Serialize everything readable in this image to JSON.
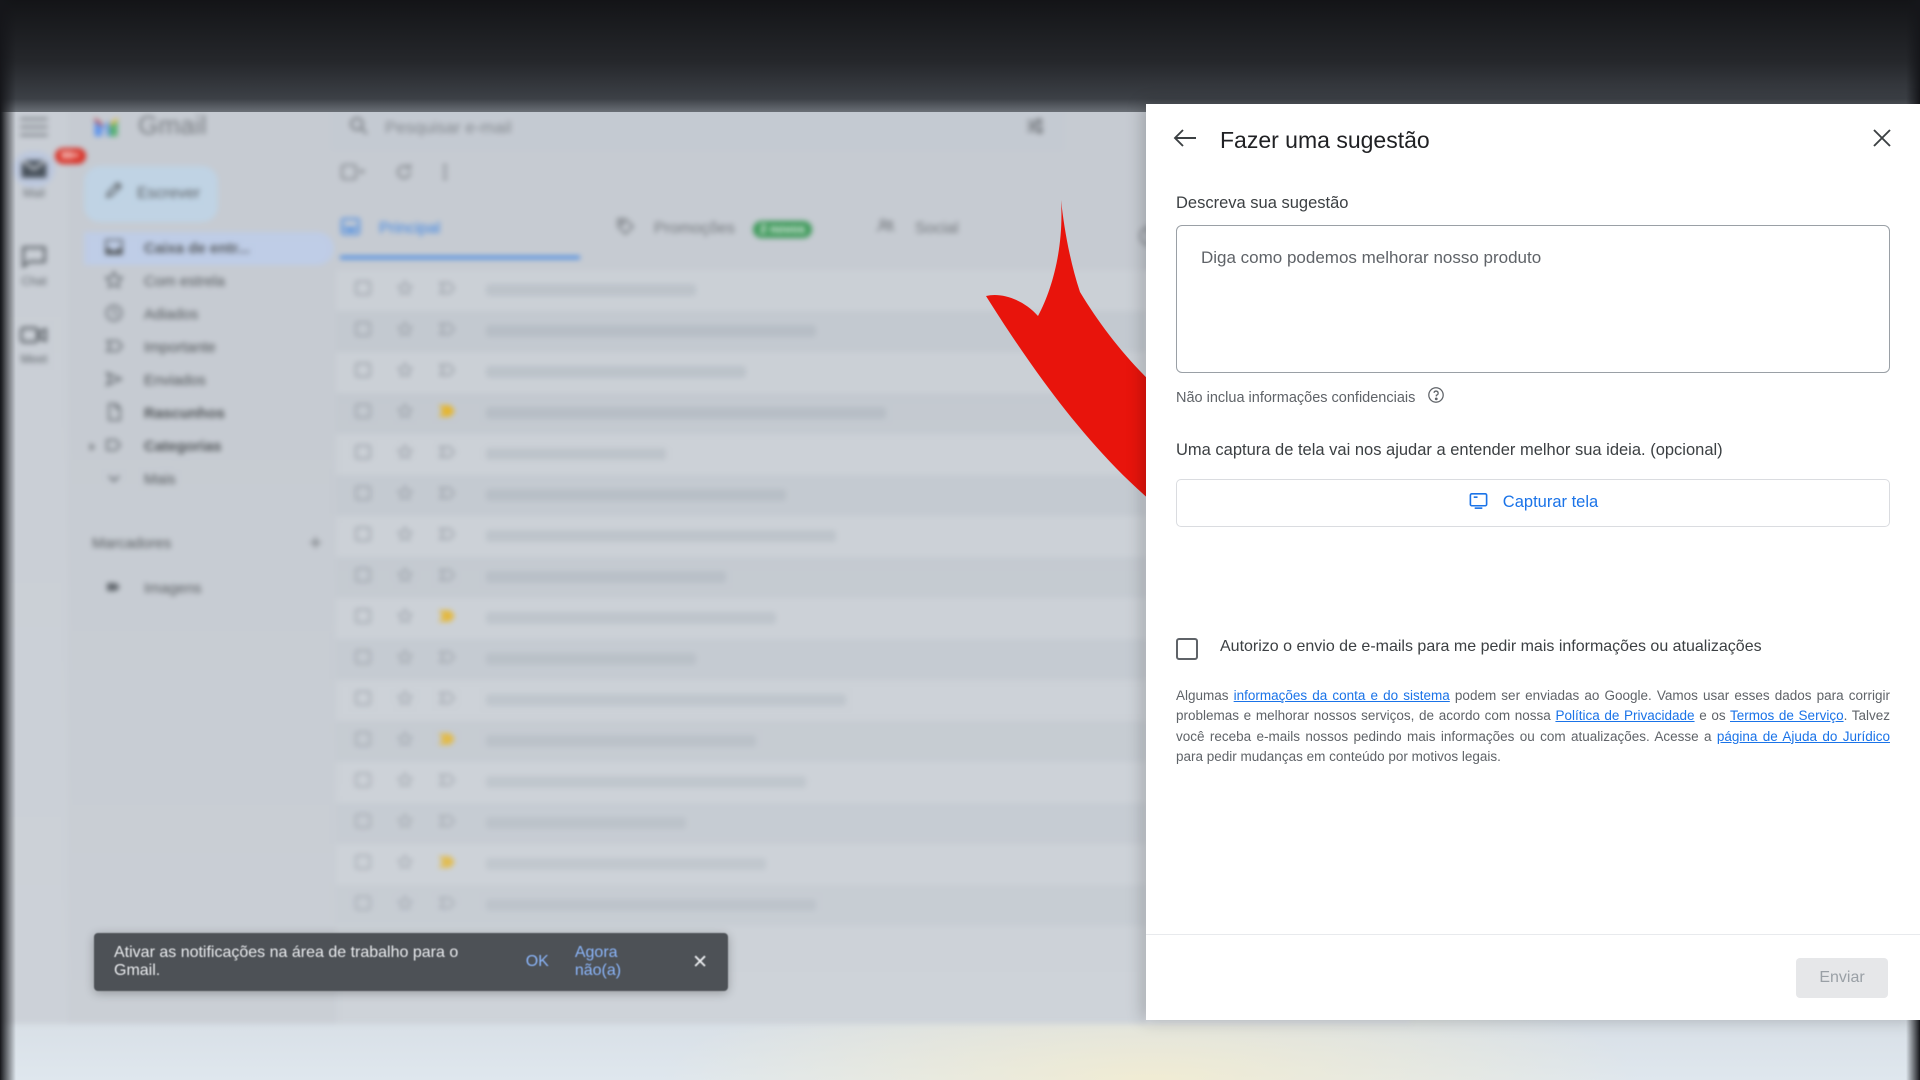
{
  "gmail": {
    "brand": "Gmail",
    "rail": [
      {
        "label": "Mail",
        "icon": "mail-icon",
        "badge": "99+",
        "active": true
      },
      {
        "label": "Chat",
        "icon": "chat-icon",
        "badge": "",
        "active": false
      },
      {
        "label": "Meet",
        "icon": "meet-icon",
        "badge": "",
        "active": false
      }
    ],
    "search": {
      "placeholder": "Pesquisar e-mail",
      "value": "",
      "icon": "search-icon",
      "options_icon": "search-options-icon"
    },
    "compose": {
      "label": "Escrever",
      "icon": "pencil-icon"
    },
    "nav": [
      {
        "label": "Caixa de entr...",
        "icon": "inbox-icon",
        "selected": true,
        "bold": true,
        "caret": false
      },
      {
        "label": "Com estrela",
        "icon": "star-icon",
        "selected": false,
        "bold": false,
        "caret": false
      },
      {
        "label": "Adiados",
        "icon": "clock-icon",
        "selected": false,
        "bold": false,
        "caret": false
      },
      {
        "label": "Importante",
        "icon": "important-icon",
        "selected": false,
        "bold": false,
        "caret": false
      },
      {
        "label": "Enviados",
        "icon": "send-icon",
        "selected": false,
        "bold": false,
        "caret": false
      },
      {
        "label": "Rascunhos",
        "icon": "draft-icon",
        "selected": false,
        "bold": true,
        "caret": false
      },
      {
        "label": "Categorias",
        "icon": "label-icon",
        "selected": false,
        "bold": true,
        "caret": true
      },
      {
        "label": "Mais",
        "icon": "chevron-down-icon",
        "selected": false,
        "bold": false,
        "caret": false
      }
    ],
    "labels_section": {
      "title": "Marcadores",
      "add_icon": "plus-icon"
    },
    "labels": [
      {
        "label": "Imagens",
        "icon": "label-filled-icon"
      }
    ],
    "toolbar": {
      "select_icon": "select-checkbox-icon",
      "refresh_icon": "refresh-icon",
      "more_icon": "more-vertical-icon"
    },
    "tabs": [
      {
        "label": "Principal",
        "icon": "inbox-tab-icon",
        "active": true,
        "badge": ""
      },
      {
        "label": "Promoções",
        "icon": "tag-icon",
        "active": false,
        "badge": "2 novos"
      },
      {
        "label": "Social",
        "icon": "people-icon",
        "active": false,
        "badge": ""
      }
    ],
    "tabs_info_icon": "info-icon",
    "rows": [
      {
        "important": false
      },
      {
        "important": false
      },
      {
        "important": false
      },
      {
        "important": true
      },
      {
        "important": false
      },
      {
        "important": false
      },
      {
        "important": false
      },
      {
        "important": false
      },
      {
        "important": true
      },
      {
        "important": false
      },
      {
        "important": false
      },
      {
        "important": true
      },
      {
        "important": false
      },
      {
        "important": false
      },
      {
        "important": true
      },
      {
        "important": false
      }
    ],
    "row_icons": {
      "checkbox": "checkbox-icon",
      "star": "star-outline-icon",
      "important": "important-marker-icon"
    }
  },
  "toast": {
    "message": "Ativar as notificações na área de trabalho para o Gmail.",
    "ok_label": "OK",
    "later_label": "Agora não(a)",
    "close_icon": "close-icon"
  },
  "annotation": {
    "arrow_icon": "curved-arrow-icon",
    "color": "#e8140c"
  },
  "dialog": {
    "back_icon": "back-arrow-icon",
    "title": "Fazer uma sugestão",
    "close_icon": "close-icon",
    "suggestion_label": "Descreva sua sugestão",
    "suggestion_placeholder": "Diga como podemos melhorar nosso produto",
    "suggestion_value": "",
    "confidential_hint": "Não inclua informações confidenciais",
    "help_icon": "help-circle-icon",
    "screenshot_copy": "Uma captura de tela vai nos ajudar a entender melhor sua ideia. (opcional)",
    "capture_label": "Capturar tela",
    "capture_icon": "screenshot-icon",
    "consent_checked": false,
    "consent_label": "Autorizo o envio de e-mails para me pedir mais informações ou atualizações",
    "legal": {
      "p1": "Algumas ",
      "link1": "informações da conta e do sistema",
      "p2": " podem ser enviadas ao Google. Vamos usar esses dados para corrigir problemas e melhorar nossos serviços, de acordo com nossa ",
      "link2": "Política de Privacidade",
      "p3": " e os ",
      "link3": "Termos de Serviço",
      "p4": ". Talvez você receba e-mails nossos pedindo mais informações ou com atualizações. Acesse a ",
      "link4": "página de Ajuda do Jurídico",
      "p5": " para pedir mudanças em conteúdo por motivos legais."
    },
    "submit_label": "Enviar"
  }
}
